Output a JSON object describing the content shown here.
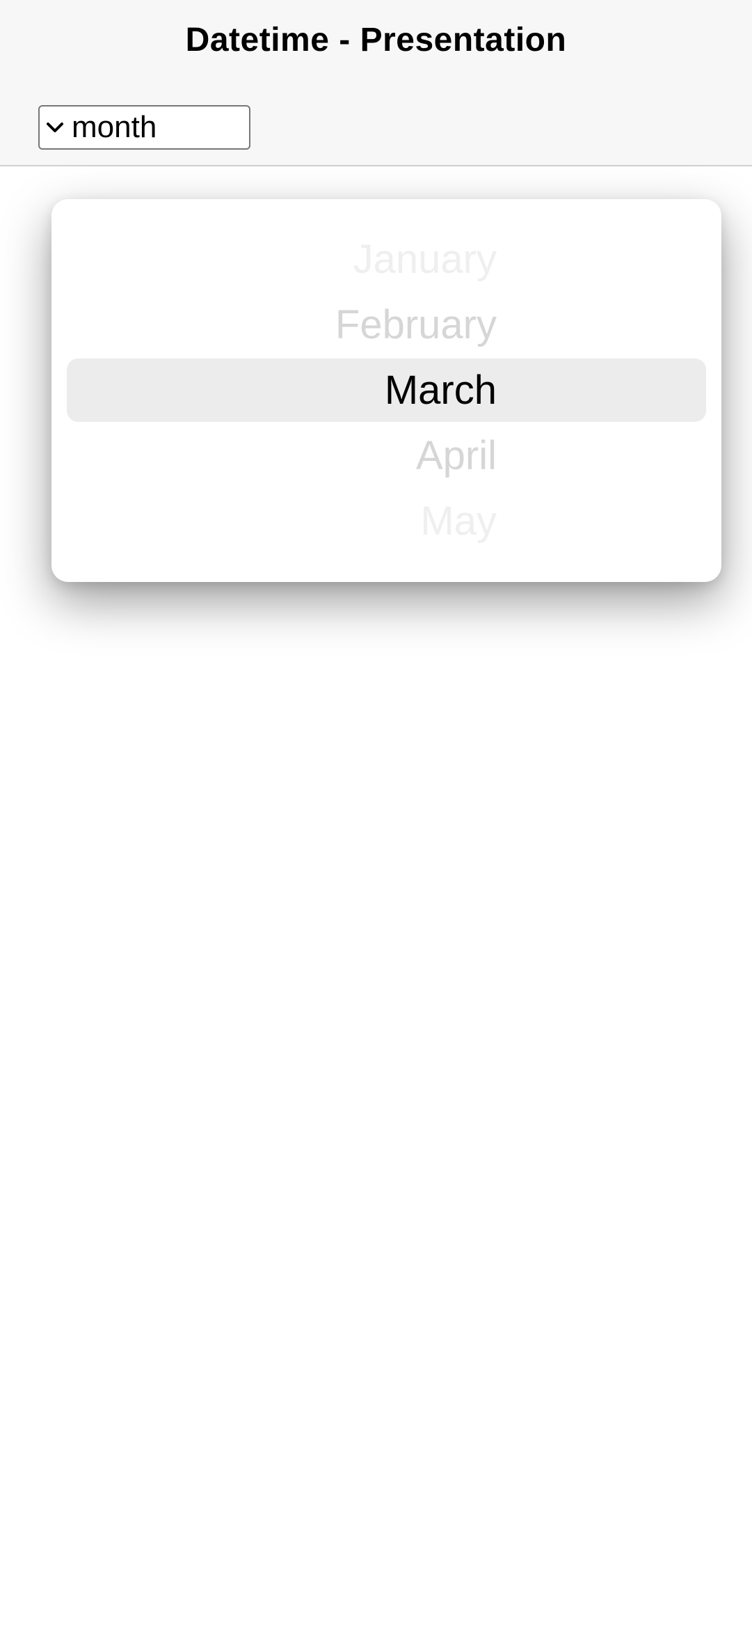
{
  "header": {
    "title": "Datetime - Presentation",
    "presentation_select": {
      "value": "month",
      "icon": "chevron-down-icon"
    }
  },
  "picker": {
    "months": [
      "January",
      "February",
      "March",
      "April",
      "May"
    ],
    "selected": "March",
    "colors": {
      "selected_text": "#000000",
      "faded_text": "#d6d6d6",
      "highlight": "#ececec"
    }
  }
}
